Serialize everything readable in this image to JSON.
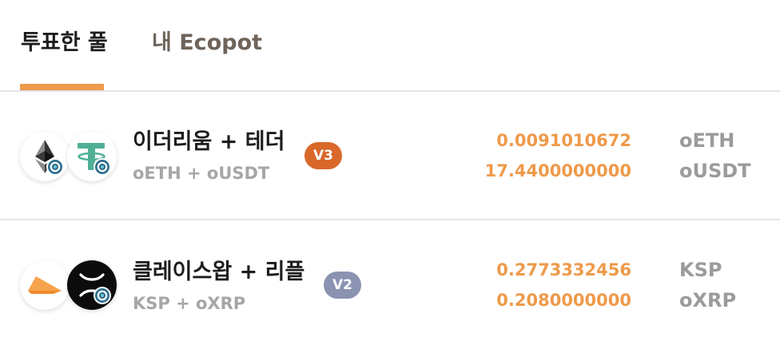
{
  "tabs": {
    "voted_pools": "투표한 풀",
    "my_ecopot": "내 Ecopot"
  },
  "colors": {
    "accent": "#ee9a4a",
    "v3_badge": "#d9682a",
    "v2_badge": "#8b93b2"
  },
  "pools": [
    {
      "name": "이더리움 + 테더",
      "symbols": "oETH + oUSDT",
      "version": "V3",
      "icons": [
        "ethereum-icon",
        "tether-icon"
      ],
      "amount_1": "0.0091010672",
      "amount_2": "17.4400000000",
      "token_1": "oETH",
      "token_2": "oUSDT"
    },
    {
      "name": "클레이스왑 + 리플",
      "symbols": "KSP + oXRP",
      "version": "V2",
      "icons": [
        "klayswap-icon",
        "ripple-icon"
      ],
      "amount_1": "0.2773332456",
      "amount_2": "0.2080000000",
      "token_1": "KSP",
      "token_2": "oXRP"
    }
  ]
}
